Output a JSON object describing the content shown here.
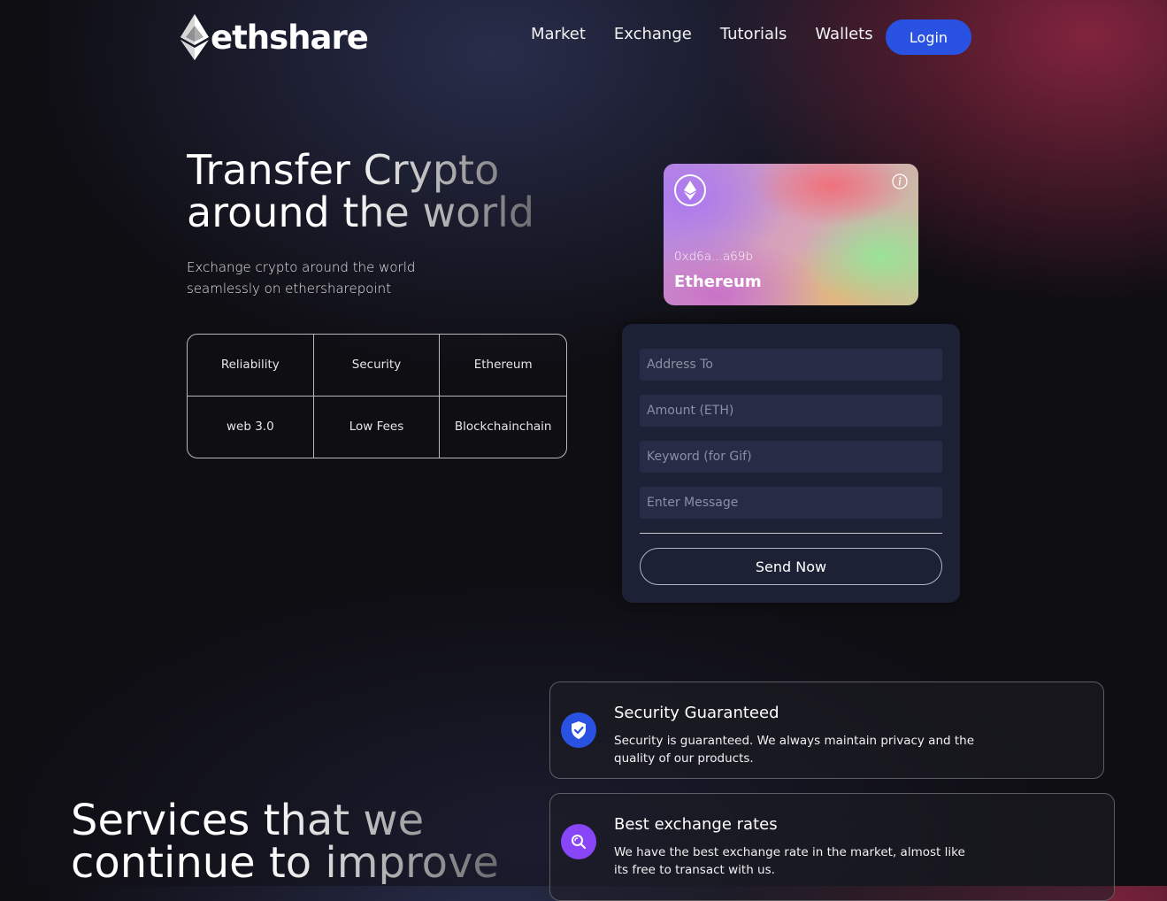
{
  "header": {
    "logo_text": "ethshare",
    "nav": [
      "Market",
      "Exchange",
      "Tutorials",
      "Wallets"
    ],
    "login_label": "Login",
    "login_color": "#2952e3"
  },
  "hero": {
    "title_line1": "Transfer Crypto",
    "title_line2": "around the world",
    "subtitle": "Exchange crypto around the world seamlessly on ethersharepoint",
    "features": [
      "Reliability",
      "Security",
      "Ethereum",
      "web 3.0",
      "Low Fees",
      "Blockchainchain"
    ]
  },
  "card": {
    "address": "0xd6a...a69b",
    "label": "Ethereum",
    "icons": [
      "ethereum-icon",
      "info-icon"
    ]
  },
  "form": {
    "address_placeholder": "Address To",
    "amount_placeholder": "Amount (ETH)",
    "keyword_placeholder": "Keyword (for Gif)",
    "message_placeholder": "Enter Message",
    "send_label": "Send Now"
  },
  "services": {
    "title_line1": "Services that we",
    "title_line2": "continue to improve",
    "items": [
      {
        "title": "Security Guaranteed",
        "description": "Security is guaranteed. We always maintain privacy and the quality of our products.",
        "icon": "shield-check-icon",
        "color": "#2952e3"
      },
      {
        "title": "Best exchange rates",
        "description": "We have the best exchange rate in the market, almost like its free to transact with us.",
        "icon": "search-icon",
        "color": "#8945f8"
      }
    ]
  }
}
